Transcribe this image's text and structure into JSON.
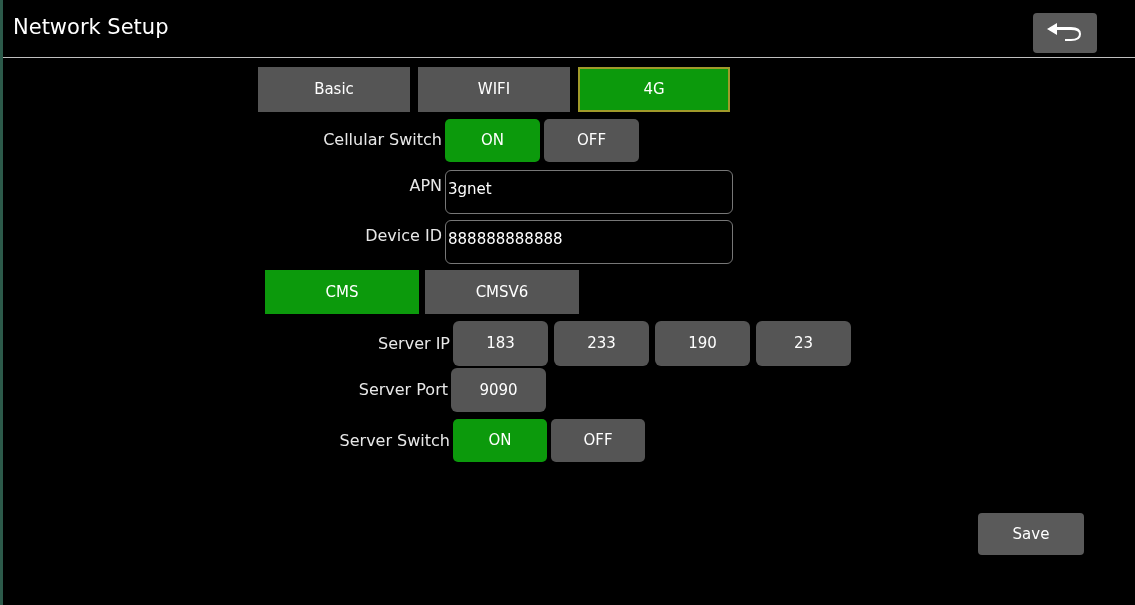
{
  "window": {
    "title": "Network Setup"
  },
  "tabs": [
    {
      "label": "Basic",
      "selected": false
    },
    {
      "label": "WIFI",
      "selected": false
    },
    {
      "label": "4G",
      "selected": true
    }
  ],
  "cellular_switch": {
    "label": "Cellular Switch",
    "options": [
      {
        "label": "ON",
        "selected": true
      },
      {
        "label": "OFF",
        "selected": false
      }
    ]
  },
  "fields": [
    {
      "label": "APN",
      "value": "3gnet"
    },
    {
      "label": "Device ID",
      "value": "888888888888"
    }
  ],
  "protocol_tabs": [
    {
      "label": "CMS",
      "selected": true
    },
    {
      "label": "CMSV6",
      "selected": false
    }
  ],
  "server_ip": {
    "label": "Server IP",
    "octets": [
      "183",
      "233",
      "190",
      "23"
    ]
  },
  "server_port": {
    "label": "Server Port",
    "value": "9090"
  },
  "server_switch": {
    "label": "Server Switch",
    "options": [
      {
        "label": "ON",
        "selected": true
      },
      {
        "label": "OFF",
        "selected": false
      }
    ]
  },
  "save_button": "Save"
}
